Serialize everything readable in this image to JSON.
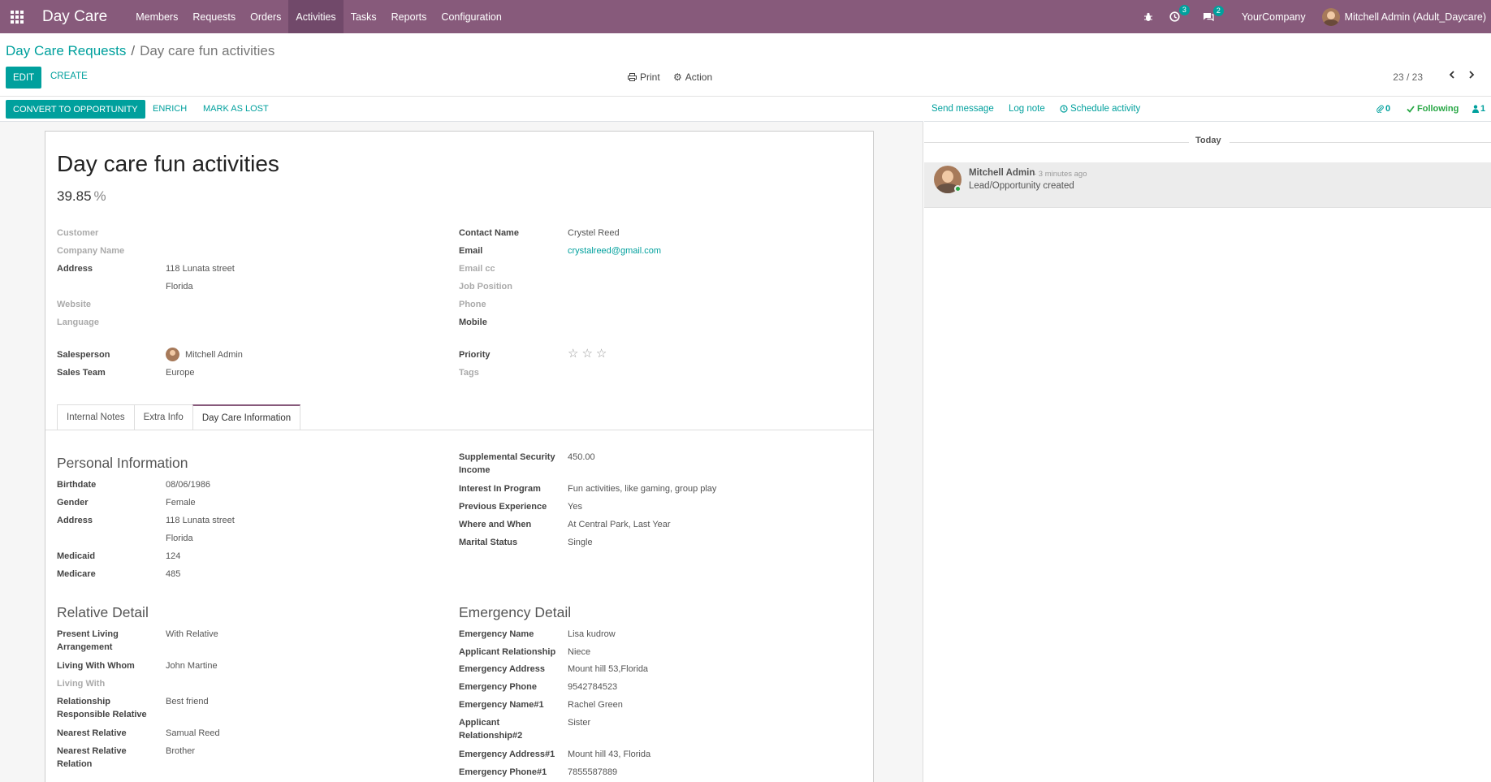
{
  "navbar": {
    "brand": "Day Care",
    "menu": [
      "Members",
      "Requests",
      "Orders",
      "Activities",
      "Tasks",
      "Reports",
      "Configuration"
    ],
    "active_menu": "Activities",
    "activity_count": "3",
    "message_count": "2",
    "company": "YourCompany",
    "user": "Mitchell Admin (Adult_Daycare)"
  },
  "breadcrumb": {
    "parent": "Day Care Requests",
    "separator": "/",
    "current": "Day care fun activities"
  },
  "toolbar": {
    "edit": "EDIT",
    "create": "CREATE",
    "print": "Print",
    "action": "Action",
    "pager": "23 / 23"
  },
  "statusbar": {
    "convert": "CONVERT TO OPPORTUNITY",
    "enrich": "ENRICH",
    "mark_lost": "MARK AS LOST"
  },
  "form": {
    "title": "Day care fun activities",
    "probability": "39.85",
    "probability_unit": "%",
    "left": {
      "customer_label": "Customer",
      "company_label": "Company Name",
      "address_label": "Address",
      "address_line1": "118 Lunata street",
      "address_line2": "Florida",
      "website_label": "Website",
      "language_label": "Language",
      "salesperson_label": "Salesperson",
      "salesperson": "Mitchell Admin",
      "team_label": "Sales Team",
      "team": "Europe"
    },
    "right": {
      "contact_label": "Contact Name",
      "contact": "Crystel Reed",
      "email_label": "Email",
      "email": "crystalreed@gmail.com",
      "emailcc_label": "Email cc",
      "job_label": "Job Position",
      "phone_label": "Phone",
      "mobile_label": "Mobile",
      "priority_label": "Priority",
      "priority_stars": 0,
      "tags_label": "Tags"
    },
    "tabs": [
      "Internal Notes",
      "Extra Info",
      "Day Care Information"
    ],
    "active_tab": "Day Care Information"
  },
  "daycare": {
    "personal_title": "Personal Information",
    "birthdate_label": "Birthdate",
    "birthdate": "08/06/1986",
    "gender_label": "Gender",
    "gender": "Female",
    "address_label": "Address",
    "address1": "118 Lunata street",
    "address2": "Florida",
    "medicaid_label": "Medicaid",
    "medicaid": "124",
    "medicare_label": "Medicare",
    "medicare": "485",
    "ssi_label_1": "Supplemental Security",
    "ssi_label_2": "Income",
    "ssi": "450.00",
    "interest_label": "Interest In Program",
    "interest": "Fun activities, like gaming, group play",
    "experience_label": "Previous Experience",
    "experience": "Yes",
    "where_label": "Where and When",
    "where": "At Central Park, Last Year",
    "marital_label": "Marital Status",
    "marital": "Single",
    "relative_title": "Relative Detail",
    "living_arr_label_1": "Present Living",
    "living_arr_label_2": "Arrangement",
    "living_arr": "With Relative",
    "living_whom_label": "Living With Whom",
    "living_whom": "John Martine",
    "living_with_label": "Living With",
    "rel_resp_label_1": "Relationship",
    "rel_resp_label_2": "Responsible Relative",
    "rel_resp": "Best friend",
    "nearest_label": "Nearest Relative",
    "nearest": "Samual Reed",
    "nearest_rel_label_1": "Nearest Relative",
    "nearest_rel_label_2": "Relation",
    "nearest_rel": "Brother",
    "emergency_title": "Emergency Detail",
    "em_name_label": "Emergency Name",
    "em_name": "Lisa kudrow",
    "app_rel_label": "Applicant Relationship",
    "app_rel": "Niece",
    "em_addr_label": "Emergency Address",
    "em_addr": "Mount hill 53,Florida",
    "em_phone_label": "Emergency Phone",
    "em_phone": "9542784523",
    "em_name1_label": "Emergency Name#1",
    "em_name1": "Rachel Green",
    "app_rel2_label_1": "Applicant",
    "app_rel2_label_2": "Relationship#2",
    "app_rel2": "Sister",
    "em_addr1_label": "Emergency Address#1",
    "em_addr1": "Mount hill 43, Florida",
    "em_phone1_label": "Emergency Phone#1",
    "em_phone1": "7855587889"
  },
  "chatter": {
    "send_message": "Send message",
    "log_note": "Log note",
    "schedule_activity": "Schedule activity",
    "attachments": "0",
    "following": "Following",
    "followers": "1",
    "today": "Today",
    "message": {
      "author": "Mitchell Admin",
      "time": "- 3 minutes ago",
      "body": "Lead/Opportunity created"
    }
  },
  "colors": {
    "brand": "#875a7b",
    "accent": "#00a09d",
    "following": "#28a745"
  }
}
